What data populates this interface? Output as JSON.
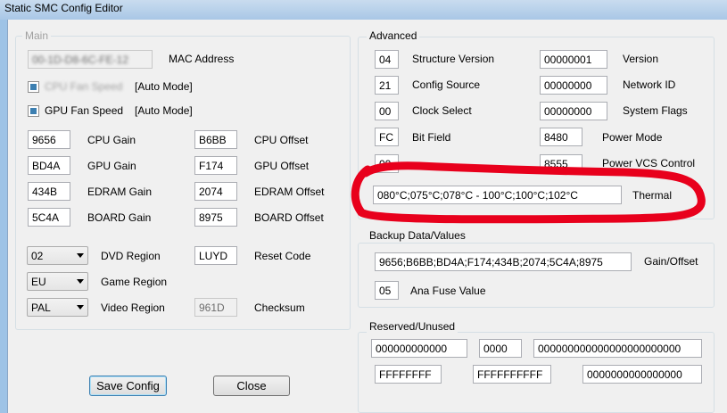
{
  "window": {
    "title": "Static SMC Config Editor"
  },
  "main": {
    "group_label": "Main",
    "mac_value": "00-1D-D8-6C-FE-12",
    "mac_label": "MAC Address",
    "cpu_fan_label": "CPU Fan Speed",
    "cpu_fan_mode": "[Auto Mode]",
    "gpu_fan_label": "GPU Fan Speed",
    "gpu_fan_mode": "[Auto Mode]",
    "gains": [
      {
        "value": "9656",
        "label": "CPU Gain"
      },
      {
        "value": "BD4A",
        "label": "GPU Gain"
      },
      {
        "value": "434B",
        "label": "EDRAM Gain"
      },
      {
        "value": "5C4A",
        "label": "BOARD Gain"
      }
    ],
    "offsets": [
      {
        "value": "B6BB",
        "label": "CPU Offset"
      },
      {
        "value": "F174",
        "label": "GPU Offset"
      },
      {
        "value": "2074",
        "label": "EDRAM Offset"
      },
      {
        "value": "8975",
        "label": "BOARD Offset"
      }
    ],
    "dvd_region": {
      "value": "02",
      "label": "DVD Region"
    },
    "game_region": {
      "value": "EU",
      "label": "Game Region"
    },
    "video_region": {
      "value": "PAL",
      "label": "Video Region"
    },
    "reset_code": {
      "value": "LUYD",
      "label": "Reset Code"
    },
    "checksum": {
      "value": "961D",
      "label": "Checksum"
    }
  },
  "advanced": {
    "group_label": "Advanced",
    "left": [
      {
        "value": "04",
        "label": "Structure Version"
      },
      {
        "value": "21",
        "label": "Config Source"
      },
      {
        "value": "00",
        "label": "Clock Select"
      },
      {
        "value": "FC",
        "label": "Bit Field"
      }
    ],
    "right": [
      {
        "value": "00000001",
        "label": "Version"
      },
      {
        "value": "00000000",
        "label": "Network ID"
      },
      {
        "value": "00000000",
        "label": "System Flags"
      },
      {
        "value": "8480",
        "label": "Power Mode"
      },
      {
        "value": "8555",
        "label": "Power VCS Control"
      }
    ],
    "hidden_value": "00",
    "thermal": {
      "value": "080°C;075°C;078°C  -  100°C;100°C;102°C",
      "label": "Thermal"
    },
    "highlight_color": "#e8001c"
  },
  "backup": {
    "group_label": "Backup Data/Values",
    "gain_offset": {
      "value": "9656;B6BB;BD4A;F174;434B;2074;5C4A;8975",
      "label": "Gain/Offset"
    },
    "ana_fuse": {
      "value": "05",
      "label": "Ana Fuse Value"
    }
  },
  "reserved": {
    "group_label": "Reserved/Unused",
    "row1": [
      "000000000000",
      "0000",
      "000000000000000000000000"
    ],
    "row2": [
      "FFFFFFFF",
      "FFFFFFFFFF",
      "0000000000000000"
    ]
  },
  "buttons": {
    "save": "Save Config",
    "close": "Close"
  }
}
